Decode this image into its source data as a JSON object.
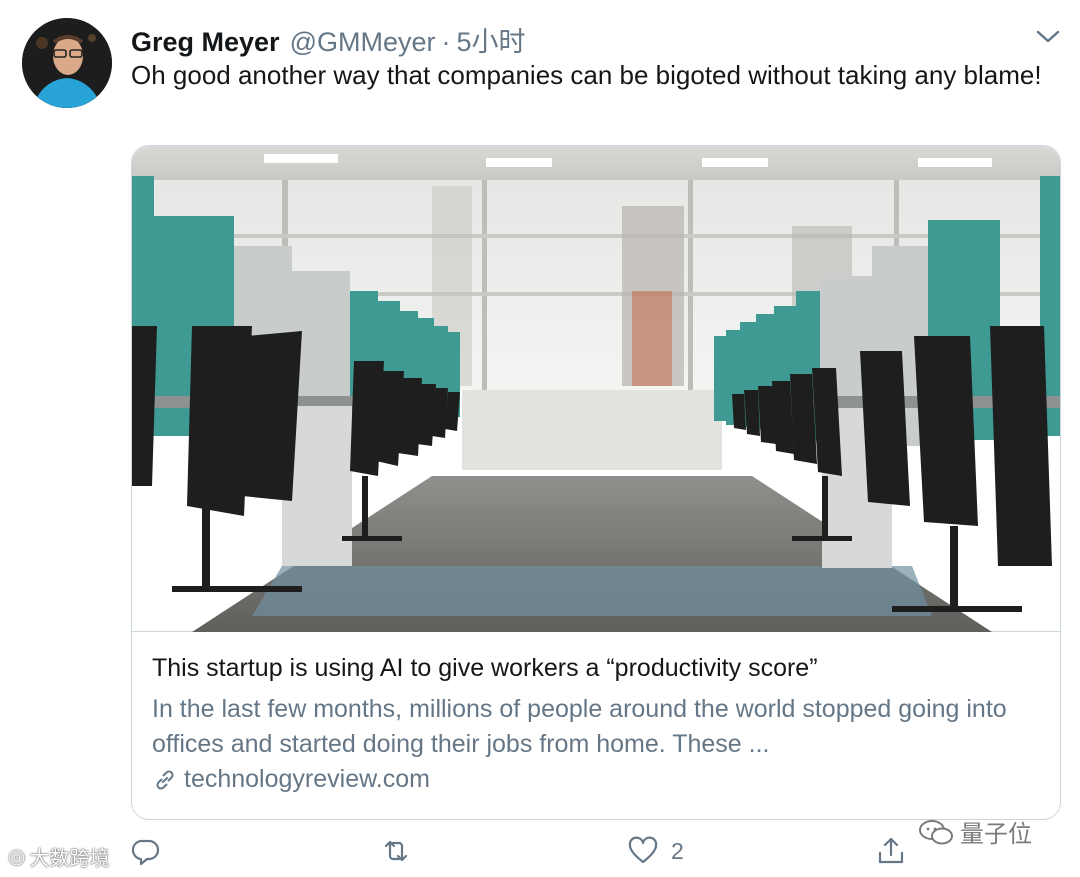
{
  "tweet": {
    "author_name": "Greg Meyer",
    "author_handle": "@GMMeyer",
    "separator": "·",
    "timestamp": "5小时",
    "text": "Oh good another way that companies can be bigoted without taking any blame!"
  },
  "card": {
    "title": "This startup is using AI to give workers a “productivity score”",
    "description": "In the last few months, millions of people around the world stopped going into offices and started doing their jobs from home. These ...",
    "domain": "technologyreview.com"
  },
  "actions": {
    "reply_count": "",
    "retweet_count": "",
    "like_count": "2",
    "share_icon": "share-icon"
  },
  "watermarks": {
    "left": "大数跨境",
    "right": "量子位"
  },
  "colors": {
    "text_primary": "#14171a",
    "text_secondary": "#657786",
    "border": "#ccd6dd",
    "accent_teal": "#3e9a92"
  }
}
